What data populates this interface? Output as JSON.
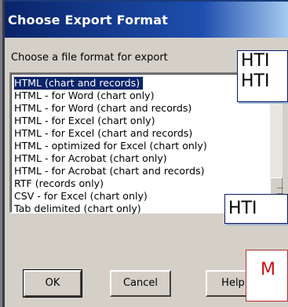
{
  "window": {
    "title": "Choose Export Format"
  },
  "prompt": "Choose a file format for export",
  "formats": [
    "HTML (chart and records)",
    "HTML - for Word (chart only)",
    "HTML - for Word (chart and records)",
    "HTML - for Excel (chart only)",
    "HTML - for Excel (chart and records)",
    "HTML - optimized for Excel (chart only)",
    "HTML - for Acrobat (chart only)",
    "HTML - for Acrobat (chart and records)",
    "RTF (records only)",
    "CSV - for Excel (chart only)",
    "Tab delimited (chart only)"
  ],
  "selected_index": 0,
  "buttons": {
    "ok": "OK",
    "cancel": "Cancel",
    "help": "Help"
  },
  "overlays": {
    "top_lines": [
      "HTI",
      "HTI"
    ],
    "middle": "HTI",
    "bottom": "M"
  },
  "colors": {
    "titlebar": "#0a246a",
    "selection": "#0a246a",
    "warning_text": "#cc1010"
  }
}
